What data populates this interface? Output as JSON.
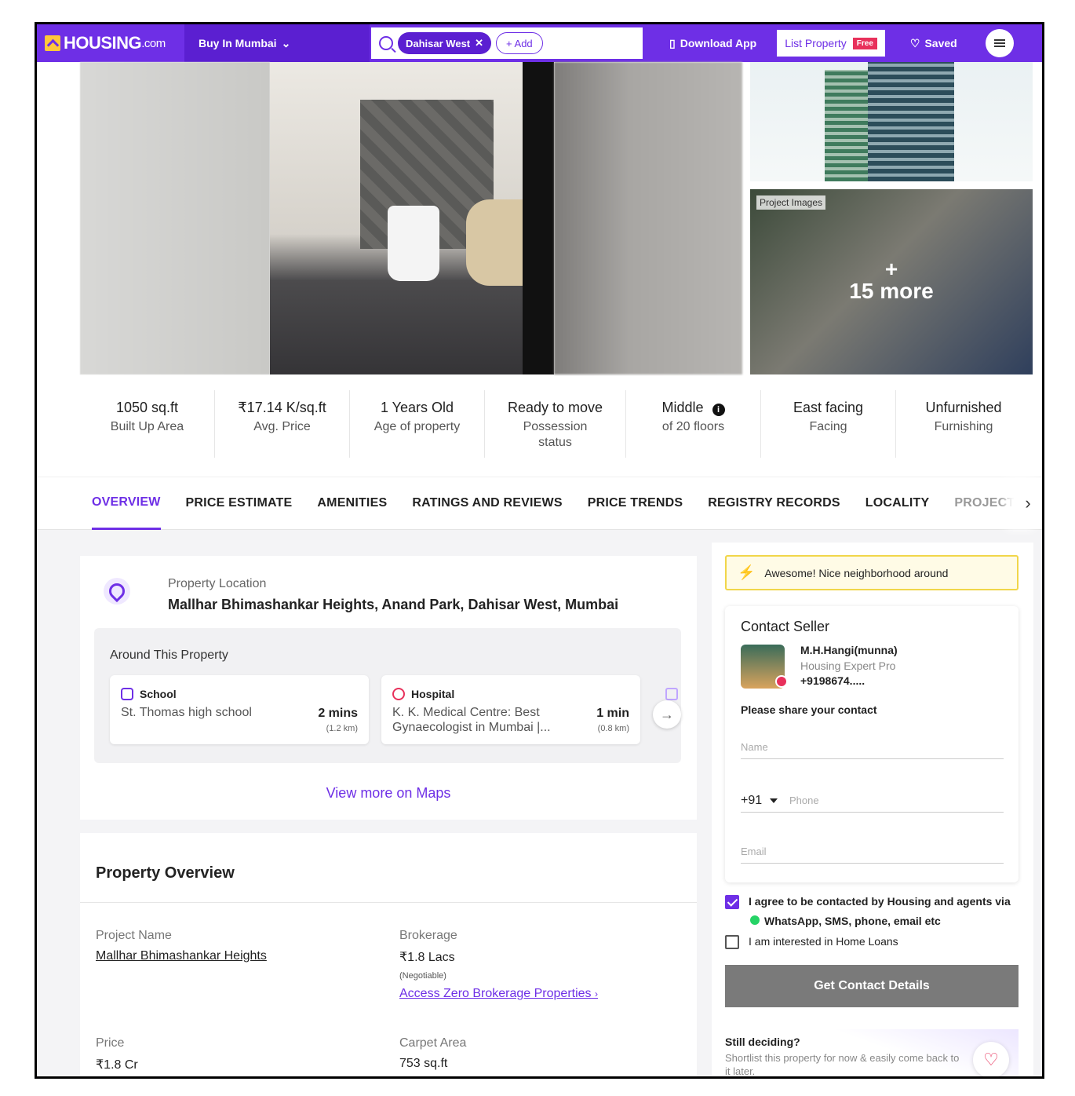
{
  "header": {
    "logo_text": "HOUSING",
    "logo_suffix": ".com",
    "buy_in": "Buy In Mumbai",
    "search_chip": "Dahisar West",
    "add_label": "+ Add",
    "download_app": "Download App",
    "list_property": "List Property",
    "free_badge": "Free",
    "saved": "Saved"
  },
  "gallery": {
    "project_tag": "Project Images",
    "more_plus": "+",
    "more_label": "15 more"
  },
  "stats": [
    {
      "value": "1050 sq.ft",
      "label": "Built Up Area"
    },
    {
      "value": "₹17.14 K/sq.ft",
      "label": "Avg. Price"
    },
    {
      "value": "1 Years Old",
      "label": "Age of property"
    },
    {
      "value": "Ready to move",
      "label": "Possession status"
    },
    {
      "value": "Middle",
      "label": "of 20 floors"
    },
    {
      "value": "East facing",
      "label": "Facing"
    },
    {
      "value": "Unfurnished",
      "label": "Furnishing"
    }
  ],
  "tabs": [
    "OVERVIEW",
    "PRICE ESTIMATE",
    "AMENITIES",
    "RATINGS AND REVIEWS",
    "PRICE TRENDS",
    "REGISTRY RECORDS",
    "LOCALITY",
    "PROJECT Q&"
  ],
  "location": {
    "label": "Property Location",
    "value": "Mallhar Bhimashankar Heights, Anand Park, Dahisar West, Mumbai",
    "around_title": "Around This Property",
    "places": [
      {
        "category": "School",
        "name": "St. Thomas high school",
        "time": "2 mins",
        "distance": "(1.2 km)"
      },
      {
        "category": "Hospital",
        "name": "K. K. Medical Centre: Best Gynaecologist in Mumbai |...",
        "time": "1 min",
        "distance": "(0.8 km)"
      }
    ],
    "maps_link": "View more on Maps"
  },
  "overview": {
    "title": "Property Overview",
    "project_name_label": "Project Name",
    "project_name": "Mallhar Bhimashankar Heights",
    "brokerage_label": "Brokerage",
    "brokerage": "₹1.8 Lacs",
    "brokerage_note": "(Negotiable)",
    "zero_brokerage": "Access Zero Brokerage Properties",
    "price_label": "Price",
    "price": "₹1.8 Cr",
    "carpet_label": "Carpet Area",
    "carpet": "753 sq.ft"
  },
  "side": {
    "banner": "Awesome! Nice neighborhood around",
    "contact_title": "Contact Seller",
    "agent_name": "M.H.Hangi(munna)",
    "agent_role": "Housing Expert Pro",
    "agent_phone": "+9198674.....",
    "share_text": "Please share your contact",
    "name_placeholder": "Name",
    "country_code": "+91",
    "phone_placeholder": "Phone",
    "email_placeholder": "Email",
    "agree_text_1": "I agree to be contacted by Housing and agents via",
    "agree_text_2": "WhatsApp, SMS, phone, email etc",
    "home_loans": "I am interested in Home Loans",
    "cta": "Get Contact Details",
    "still_title": "Still deciding?",
    "still_text": "Shortlist this property for now & easily come back to it later."
  },
  "icons": {
    "search": "search-icon",
    "close": "close-icon",
    "phone": "phone-icon",
    "heart": "heart-icon",
    "menu": "menu-icon",
    "info": "info-icon",
    "bolt": "bolt-icon"
  },
  "colors": {
    "brand": "#6e2fe6",
    "brand_dark": "#5b1fd1",
    "accent_red": "#e8315b",
    "banner_bg": "#fffbe6",
    "cta_disabled": "#7a7a7a"
  }
}
